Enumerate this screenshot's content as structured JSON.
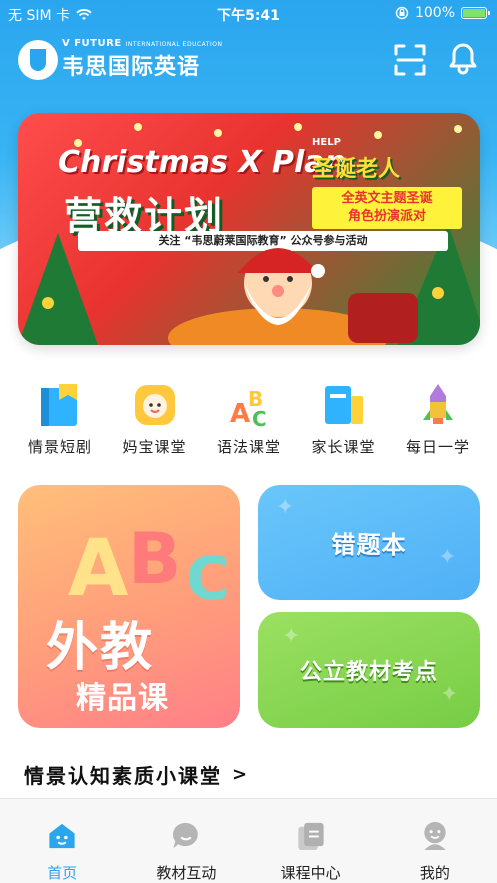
{
  "status_bar": {
    "carrier": "无 SIM 卡",
    "time": "下午5:41",
    "battery": "100%"
  },
  "header": {
    "logo_en": "V FUTURE",
    "logo_en_sub": "INTERNATIONAL EDUCATION",
    "logo_cn": "韦思国际英语",
    "scan_icon": "scan-icon",
    "bell_icon": "bell-icon"
  },
  "banner": {
    "title_en": "Christmas X Plan",
    "help": "HELP",
    "side_title": "圣诞老人",
    "title_cn": "营救计划",
    "tag_line1": "全英文主题圣诞",
    "tag_line2": "角色扮演派对",
    "subline": "关注 “韦思蔚莱国际教育” 公众号参与活动"
  },
  "categories": [
    {
      "label": "情景短剧",
      "icon": "book-icon",
      "color": "#2fb3ff"
    },
    {
      "label": "妈宝课堂",
      "icon": "baby-face-icon",
      "color": "#ffc93b"
    },
    {
      "label": "语法课堂",
      "icon": "abc-letters-icon",
      "color": "#4fbf5a"
    },
    {
      "label": "家长课堂",
      "icon": "books-icon",
      "color": "#2fb3ff"
    },
    {
      "label": "每日一学",
      "icon": "rocket-icon",
      "color": "#f0c33b"
    }
  ],
  "cards": {
    "big_title": "外教",
    "big_sub": "精品课",
    "blue_label": "错题本",
    "green_label": "公立教材考点"
  },
  "section": {
    "title": "情景认知素质小课堂",
    "arrow": ">"
  },
  "tabbar": [
    {
      "label": "首页",
      "icon": "home-icon",
      "active": true
    },
    {
      "label": "教材互动",
      "icon": "chat-icon",
      "active": false
    },
    {
      "label": "课程中心",
      "icon": "course-cards-icon",
      "active": false
    },
    {
      "label": "我的",
      "icon": "profile-icon",
      "active": false
    }
  ],
  "colors": {
    "header_blue": "#2aa6ef",
    "active_tab": "#2aa6ef",
    "card_orange": "#ff9d7b",
    "card_blue": "#4fb0f6",
    "card_green": "#77cd45"
  }
}
